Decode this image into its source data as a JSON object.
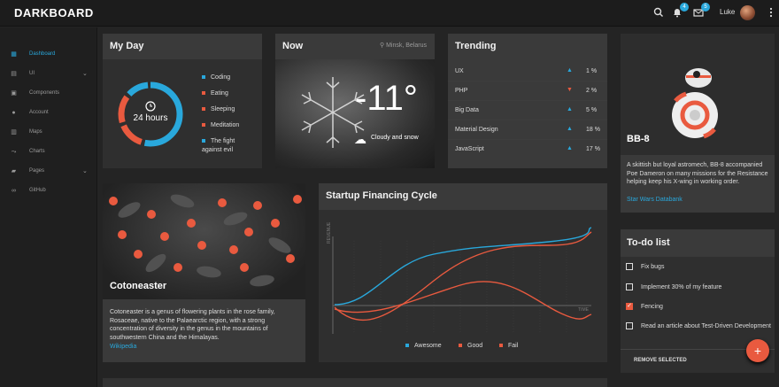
{
  "app": {
    "title": "DARKBOARD"
  },
  "topbar": {
    "notif_count": "4",
    "mail_count": "5",
    "user_name": "Luke"
  },
  "sidebar": {
    "items": [
      {
        "label": "Dashboard",
        "icon": "grid-icon",
        "active": true,
        "chevron": false
      },
      {
        "label": "UI",
        "icon": "layers-icon",
        "active": false,
        "chevron": true
      },
      {
        "label": "Components",
        "icon": "components-icon",
        "active": false,
        "chevron": false
      },
      {
        "label": "Account",
        "icon": "person-icon",
        "active": false,
        "chevron": false
      },
      {
        "label": "Maps",
        "icon": "map-icon",
        "active": false,
        "chevron": false
      },
      {
        "label": "Charts",
        "icon": "chart-icon",
        "active": false,
        "chevron": false
      },
      {
        "label": "Pages",
        "icon": "folder-icon",
        "active": false,
        "chevron": true
      },
      {
        "label": "GitHub",
        "icon": "link-icon",
        "active": false,
        "chevron": false
      }
    ]
  },
  "myday": {
    "title": "My Day",
    "center_label": "24 hours",
    "items": [
      {
        "label": "Coding",
        "color": "#29a8dc"
      },
      {
        "label": "Eating",
        "color": "#e95a3f"
      },
      {
        "label": "Sleeping",
        "color": "#e95a3f"
      },
      {
        "label": "Meditation",
        "color": "#e95a3f"
      },
      {
        "label": "The fight against evil",
        "color": "#29a8dc"
      }
    ]
  },
  "now": {
    "title": "Now",
    "location": "Minsk, Belarus",
    "temp": "-11°",
    "condition": "Cloudy and snow"
  },
  "trending": {
    "title": "Trending",
    "rows": [
      {
        "name": "UX",
        "dir": "up",
        "pct": "1 %"
      },
      {
        "name": "PHP",
        "dir": "down",
        "pct": "2 %"
      },
      {
        "name": "Big Data",
        "dir": "up",
        "pct": "5 %"
      },
      {
        "name": "Material Design",
        "dir": "up",
        "pct": "18 %"
      },
      {
        "name": "JavaScript",
        "dir": "up",
        "pct": "17 %"
      }
    ]
  },
  "bb8": {
    "title": "BB-8",
    "description": "A skittish but loyal astromech, BB-8 accompanied Poe Dameron on many missions for the Resistance helping keep his X-wing in working order.",
    "link": "Star Wars Databank"
  },
  "cotoneaster": {
    "title": "Cotoneaster",
    "description": "Cotoneaster is a genus of flowering plants in the rose family, Rosaceae, native to the Palaearctic region, with a strong concentration of diversity in the genus in the mountains of southwestern China and the Himalayas.",
    "link": "Wikipedia"
  },
  "financing": {
    "title": "Startup Financing Cycle",
    "y_axis": "REVENUE",
    "x_axis": "TIME",
    "legend": [
      {
        "label": "Awesome",
        "color": "#29a8dc"
      },
      {
        "label": "Good",
        "color": "#e95a3f"
      },
      {
        "label": "Fail",
        "color": "#e95a3f"
      }
    ]
  },
  "todo": {
    "title": "To-do list",
    "items": [
      {
        "text": "Fix bugs",
        "done": false
      },
      {
        "text": "Implement 30% of my feature",
        "done": false
      },
      {
        "text": "Fencing",
        "done": true
      },
      {
        "text": "Read an article about Test-Driven Development",
        "done": false
      }
    ],
    "remove_label": "REMOVE SELECTED",
    "fab_label": "+"
  },
  "colors": {
    "accent": "#29a8dc",
    "secondary": "#e95a3f"
  }
}
